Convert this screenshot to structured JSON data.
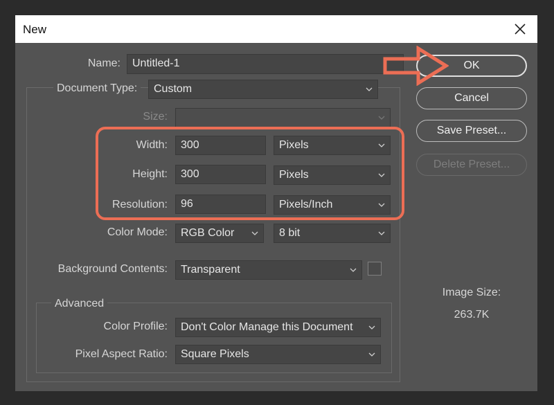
{
  "window": {
    "title": "New"
  },
  "form": {
    "name_label": "Name:",
    "name_value": "Untitled-1",
    "doctype_label": "Document Type:",
    "doctype_value": "Custom",
    "size_label": "Size:",
    "size_value": "",
    "width_label": "Width:",
    "width_value": "300",
    "width_unit": "Pixels",
    "height_label": "Height:",
    "height_value": "300",
    "height_unit": "Pixels",
    "resolution_label": "Resolution:",
    "resolution_value": "96",
    "resolution_unit": "Pixels/Inch",
    "colormode_label": "Color Mode:",
    "colormode_value": "RGB Color",
    "bitdepth_value": "8 bit",
    "background_label": "Background Contents:",
    "background_value": "Transparent"
  },
  "advanced": {
    "legend": "Advanced",
    "profile_label": "Color Profile:",
    "profile_value": "Don't Color Manage this Document",
    "aspect_label": "Pixel Aspect Ratio:",
    "aspect_value": "Square Pixels"
  },
  "buttons": {
    "ok": "OK",
    "cancel": "Cancel",
    "save_preset": "Save Preset...",
    "delete_preset": "Delete Preset..."
  },
  "image_size": {
    "label": "Image Size:",
    "value": "263.7K"
  },
  "colors": {
    "dialog_bg": "#535353",
    "highlight": "#ec6e55"
  },
  "icons": [
    "close-icon",
    "chevron-down-icon",
    "arrow-right-icon"
  ]
}
